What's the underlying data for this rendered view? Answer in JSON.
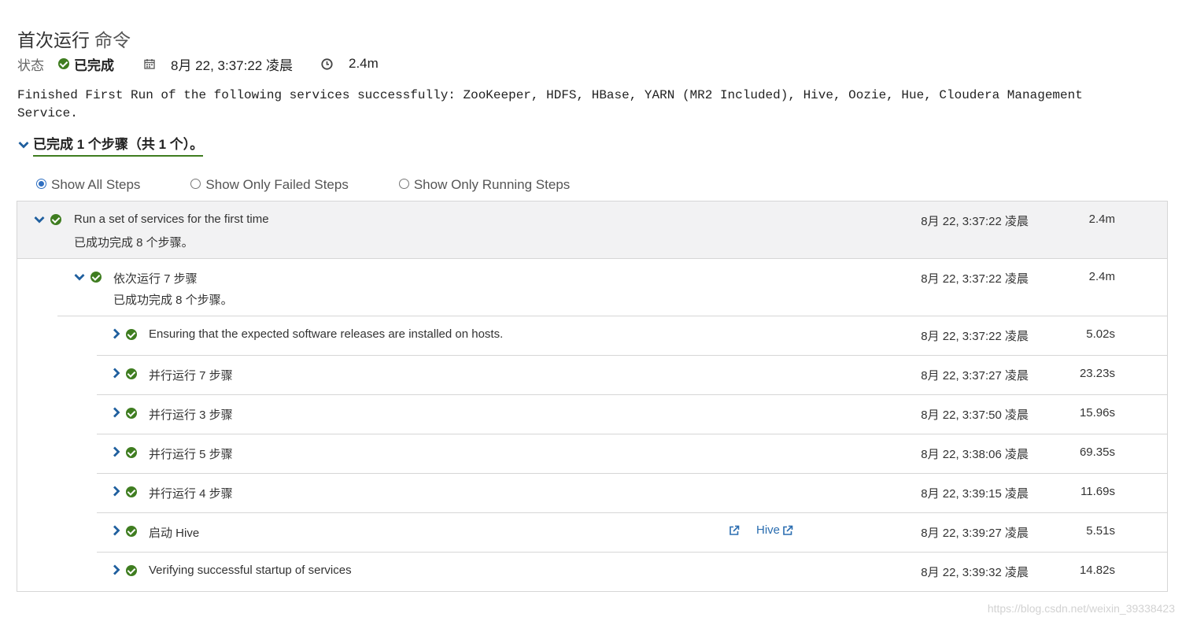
{
  "page": {
    "title": "首次运行",
    "subtitle": "命令"
  },
  "status": {
    "label": "状态",
    "value": "已完成",
    "date": "8月 22, 3:37:22 凌晨",
    "duration": "2.4m",
    "accent_color": "#3f7d20"
  },
  "message": "Finished First Run of the following services successfully: ZooKeeper, HDFS, HBase, YARN (MR2 Included), Hive, Oozie, Hue, Cloudera Management Service.",
  "summary": "已完成 1 个步骤（共 1 个）。",
  "filters": [
    {
      "label": "Show All Steps",
      "checked": true
    },
    {
      "label": "Show Only Failed Steps",
      "checked": false
    },
    {
      "label": "Show Only Running Steps",
      "checked": false
    }
  ],
  "steps": {
    "root": {
      "name": "Run a set of services for the first time",
      "detail": "已成功完成 8 个步骤。",
      "time": "8月 22, 3:37:22 凌晨",
      "duration": "2.4m",
      "expanded": true
    },
    "group": {
      "name": "依次运行 7 步骤",
      "detail": "已成功完成 8 个步骤。",
      "time": "8月 22, 3:37:22 凌晨",
      "duration": "2.4m",
      "expanded": true
    },
    "children": [
      {
        "name": "Ensuring that the expected software releases are installed on hosts.",
        "time": "8月 22, 3:37:22 凌晨",
        "duration": "5.02s"
      },
      {
        "name": "并行运行 7 步骤",
        "time": "8月 22, 3:37:27 凌晨",
        "duration": "23.23s"
      },
      {
        "name": "并行运行 3 步骤",
        "time": "8月 22, 3:37:50 凌晨",
        "duration": "15.96s"
      },
      {
        "name": "并行运行 5 步骤",
        "time": "8月 22, 3:38:06 凌晨",
        "duration": "69.35s"
      },
      {
        "name": "并行运行 4 步骤",
        "time": "8月 22, 3:39:15 凌晨",
        "duration": "11.69s"
      },
      {
        "name": "启动 Hive",
        "time": "8月 22, 3:39:27 凌晨",
        "duration": "5.51s",
        "link_label": "Hive"
      },
      {
        "name": "Verifying successful startup of services",
        "time": "8月 22, 3:39:32 凌晨",
        "duration": "14.82s"
      }
    ]
  },
  "watermark": "https://blog.csdn.net/weixin_39338423",
  "icons": {
    "status": "check-circle-icon",
    "date": "calendar-icon",
    "duration": "clock-icon",
    "expand": "chevron-down-icon",
    "collapse": "chevron-right-icon",
    "link": "external-link-icon"
  },
  "colors": {
    "success": "#3f7d20",
    "link": "#2a6db0",
    "chevron": "#1f5f9e",
    "radio": "#2f6fc1"
  }
}
